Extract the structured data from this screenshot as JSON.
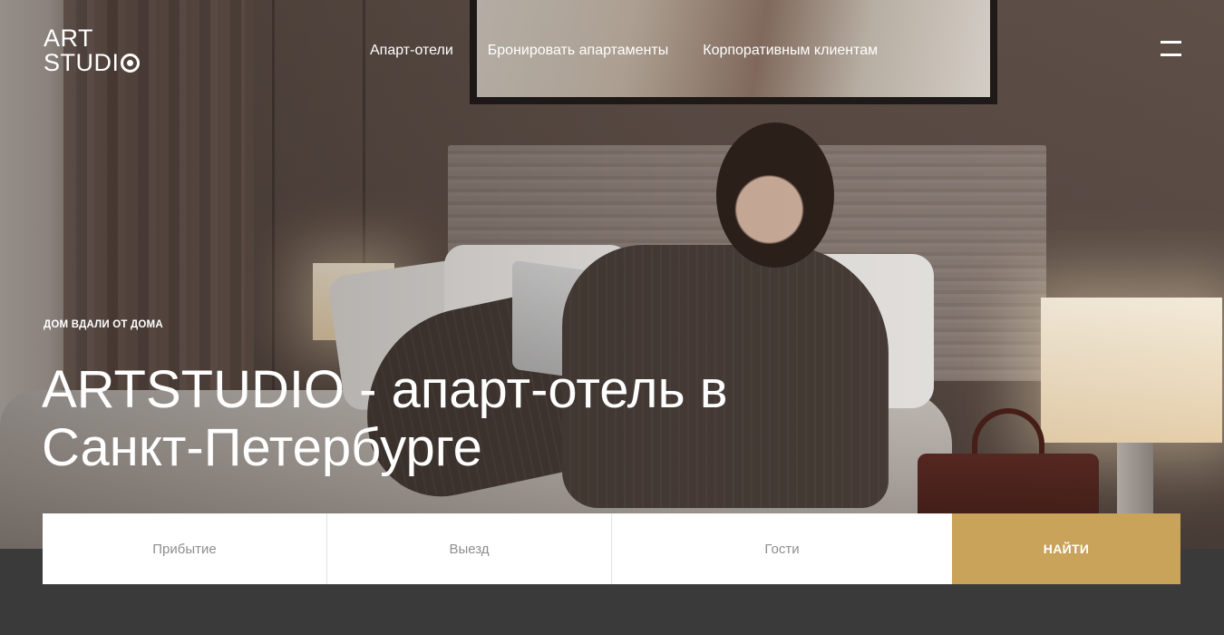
{
  "header": {
    "logo_line1": "ART",
    "logo_line2": "STUDI",
    "nav": [
      {
        "label": "Апарт-отели"
      },
      {
        "label": "Бронировать апартаменты"
      },
      {
        "label": "Корпоративным клиентам"
      }
    ],
    "menu_icon": "hamburger-menu-icon"
  },
  "hero": {
    "eyebrow": "ДОМ ВДАЛИ ОТ ДОМА",
    "title_line1": "ARTSTUDIO - апарт-отель в",
    "title_line2": "Санкт-Петербурге"
  },
  "booking": {
    "arrival_placeholder": "Прибытие",
    "departure_placeholder": "Выезд",
    "guests_placeholder": "Гости",
    "search_label": "НАЙТИ"
  },
  "colors": {
    "accent": "#c9a35a",
    "dark_band": "#3a3a3a",
    "white": "#ffffff"
  }
}
